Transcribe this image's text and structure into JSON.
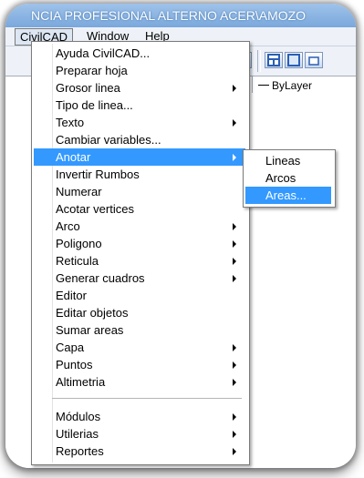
{
  "window": {
    "title": "NCIA PROFESIONAL ALTERNO ACER\\AMOZO"
  },
  "menubar": {
    "items": [
      "CivilCAD",
      "Window",
      "Help"
    ]
  },
  "properties": {
    "linetype": "ByLayer"
  },
  "menu": {
    "items": [
      {
        "label": "Ayuda CivilCAD...",
        "submenu": false
      },
      {
        "label": "Preparar hoja",
        "submenu": false
      },
      {
        "label": "Grosor linea",
        "submenu": true
      },
      {
        "label": "Tipo de linea...",
        "submenu": false
      },
      {
        "label": "Texto",
        "submenu": true
      },
      {
        "label": "Cambiar variables...",
        "submenu": false
      },
      {
        "label": "Anotar",
        "submenu": true,
        "selected": true
      },
      {
        "label": "Invertir Rumbos",
        "submenu": false
      },
      {
        "label": "Numerar",
        "submenu": false
      },
      {
        "label": "Acotar vertices",
        "submenu": false
      },
      {
        "label": "Arco",
        "submenu": true
      },
      {
        "label": "Poligono",
        "submenu": true
      },
      {
        "label": "Reticula",
        "submenu": true
      },
      {
        "label": "Generar cuadros",
        "submenu": true
      },
      {
        "label": "Editor",
        "submenu": false
      },
      {
        "label": "Editar objetos",
        "submenu": false
      },
      {
        "label": "Sumar areas",
        "submenu": false
      },
      {
        "label": "Capa",
        "submenu": true
      },
      {
        "label": "Puntos",
        "submenu": true
      },
      {
        "label": "Altimetria",
        "submenu": true
      },
      {
        "label": "Módulos",
        "submenu": true
      },
      {
        "label": "Utilerias",
        "submenu": true
      },
      {
        "label": "Reportes",
        "submenu": true
      }
    ]
  },
  "submenu": {
    "items": [
      {
        "label": "Lineas"
      },
      {
        "label": "Arcos"
      },
      {
        "label": "Areas...",
        "selected": true
      }
    ]
  },
  "colors": {
    "highlight": "#3399ff",
    "title_bar": "#7aa7dc"
  }
}
